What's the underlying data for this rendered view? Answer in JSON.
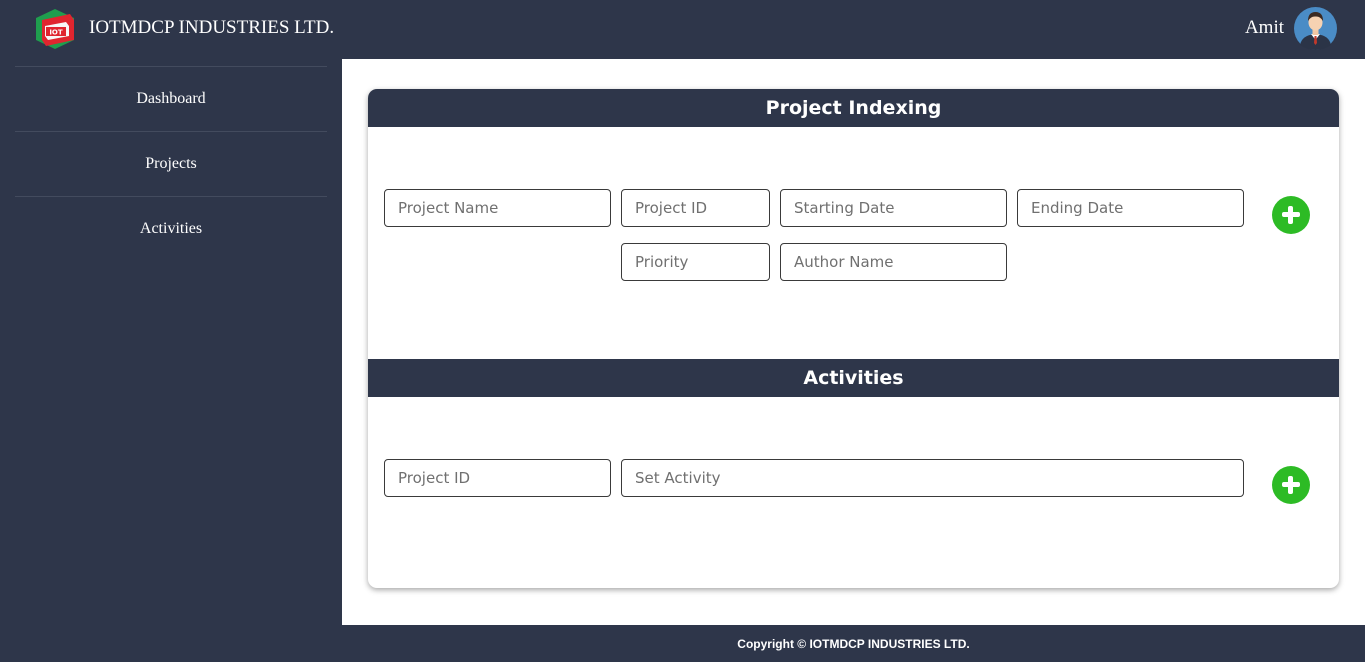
{
  "header": {
    "brand": "IOTMDCP INDUSTRIES LTD.",
    "logo_text": "IOT",
    "user_name": "Amit"
  },
  "sidebar": {
    "items": [
      {
        "label": "Dashboard"
      },
      {
        "label": "Projects"
      },
      {
        "label": "Activities"
      }
    ]
  },
  "project_indexing": {
    "title": "Project Indexing",
    "fields": {
      "project_name": {
        "placeholder": "Project Name",
        "value": ""
      },
      "project_id": {
        "placeholder": "Project ID",
        "value": ""
      },
      "starting_date": {
        "placeholder": "Starting Date",
        "value": ""
      },
      "ending_date": {
        "placeholder": "Ending Date",
        "value": ""
      },
      "priority": {
        "placeholder": "Priority",
        "value": ""
      },
      "author_name": {
        "placeholder": "Author Name",
        "value": ""
      }
    }
  },
  "activities": {
    "title": "Activities",
    "fields": {
      "project_id": {
        "placeholder": "Project ID",
        "value": ""
      },
      "set_activity": {
        "placeholder": "Set Activity",
        "value": ""
      }
    }
  },
  "footer": {
    "copyright": "Copyright © IOTMDCP INDUSTRIES LTD."
  },
  "colors": {
    "dark": "#2e364a",
    "accent_green": "#2dbb25",
    "logo_green": "#1f9e4e",
    "logo_red": "#e0252f"
  }
}
